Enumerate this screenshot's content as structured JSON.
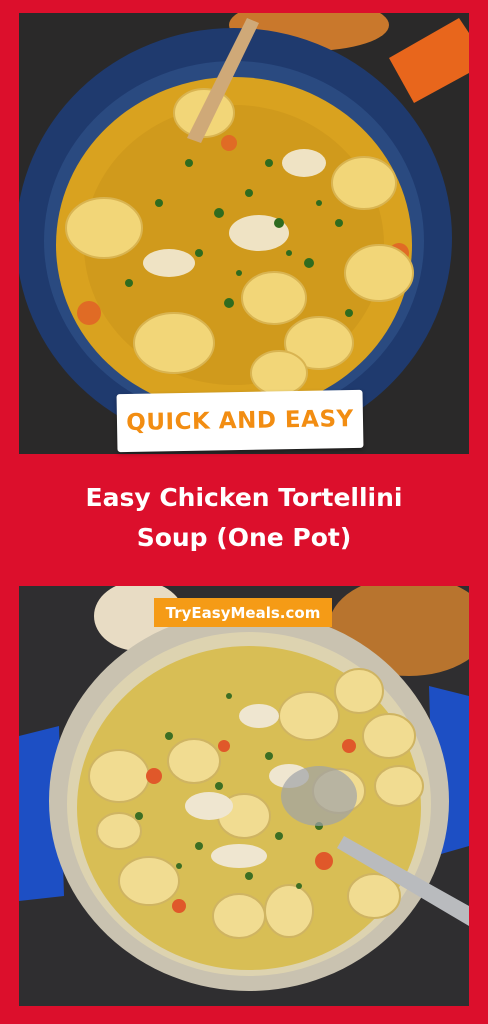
{
  "badge": {
    "text": "QUICK AND EASY"
  },
  "title": {
    "line1": "Easy Chicken Tortellini",
    "line2": "Soup (One Pot)"
  },
  "watermark": {
    "text": "TryEasyMeals.com"
  },
  "colors": {
    "background": "#dc0f2c",
    "badge_text": "#f28d12",
    "watermark_bg": "#f59b16",
    "pot_top": "#1f3a6e",
    "pot_handle_top": "#e8661c",
    "pot_bottom": "#1d4fc4",
    "broth": "#d9a21f"
  }
}
